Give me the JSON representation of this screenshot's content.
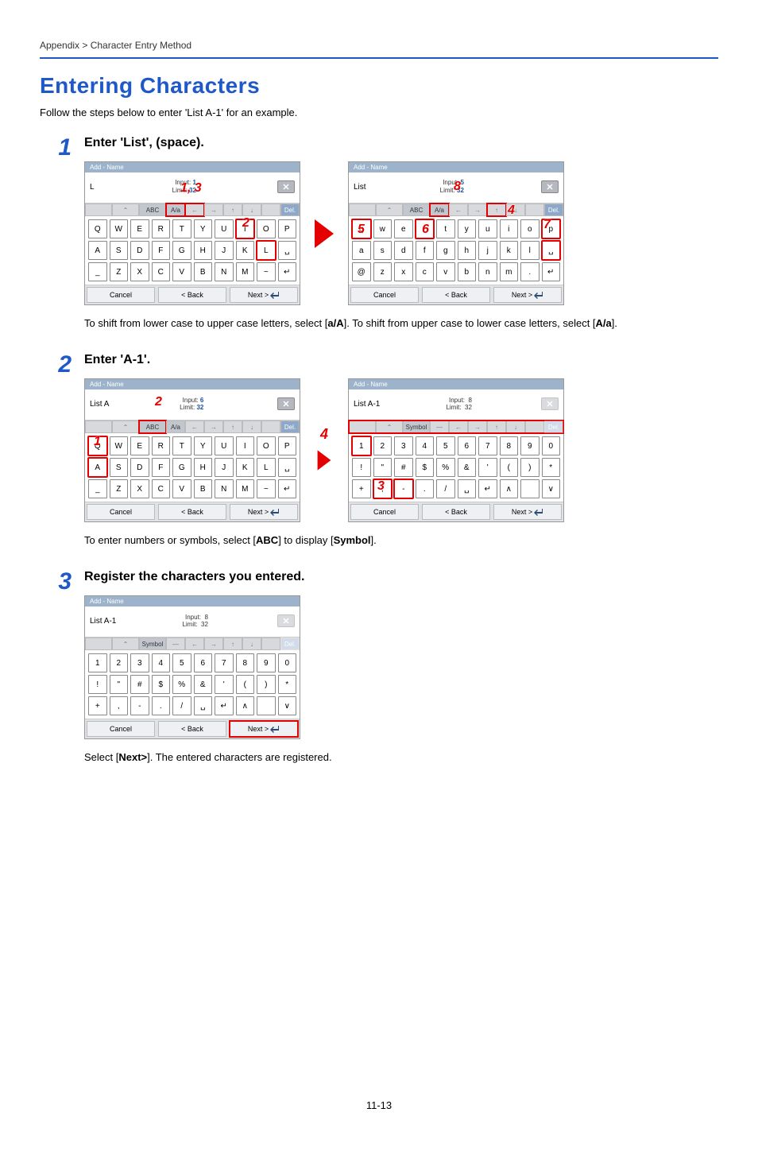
{
  "breadcrumb": "Appendix > Character Entry Method",
  "page_title": "Entering Characters",
  "intro": "Follow the steps below to enter 'List A-1' for an example.",
  "page_number": "11-13",
  "steps": [
    {
      "num": "1",
      "heading": "Enter 'List', (space).",
      "note_pre": "To shift from lower case to upper case letters, select [",
      "note_b1": "a/A",
      "note_mid": "]. To shift from upper case to lower case letters, select [",
      "note_b2": "A/a",
      "note_post": "]."
    },
    {
      "num": "2",
      "heading": "Enter 'A-1'.",
      "note_pre": "To enter numbers or symbols, select [",
      "note_b1": "ABC",
      "note_mid": "] to display [",
      "note_b2": "Symbol",
      "note_post": "]."
    },
    {
      "num": "3",
      "heading": "Register the characters you entered.",
      "note_pre": "Select [",
      "note_b1": "Next>",
      "note_mid": "]. The entered characters are registered.",
      "note_b2": "",
      "note_post": ""
    }
  ],
  "panel_common": {
    "title": "Add - Name",
    "input_label": "Input:",
    "limit_label": "Limit:",
    "limit_val": "32",
    "toolbar": {
      "abc": "ABC",
      "symbol": "Symbol",
      "aa": "A/a",
      "del": "Del."
    },
    "bottom": {
      "cancel": "Cancel",
      "back": "< Back",
      "next": "Next >"
    }
  },
  "panels": {
    "s1a": {
      "val": "L",
      "input_count": "1",
      "case": "upper",
      "callouts": {
        "c13": "1, 3",
        "c2": "2"
      },
      "rows": [
        [
          "Q",
          "W",
          "E",
          "R",
          "T",
          "Y",
          "U",
          "I",
          "O",
          "P"
        ],
        [
          "A",
          "S",
          "D",
          "F",
          "G",
          "H",
          "J",
          "K",
          "L",
          "␣"
        ],
        [
          "_",
          "Z",
          "X",
          "C",
          "V",
          "B",
          "N",
          "M",
          "~",
          "↵"
        ]
      ]
    },
    "s1b": {
      "val": "List",
      "input_count": "5",
      "case": "lower",
      "callouts": {
        "c4": "4",
        "c5": "5",
        "c6": "6",
        "c7": "7",
        "c8": "8"
      },
      "rows": [
        [
          "q",
          "w",
          "e",
          "r",
          "t",
          "y",
          "u",
          "i",
          "o",
          "p"
        ],
        [
          "a",
          "s",
          "d",
          "f",
          "g",
          "h",
          "j",
          "k",
          "l",
          "␣"
        ],
        [
          "@",
          "z",
          "x",
          "c",
          "v",
          "b",
          "n",
          "m",
          ".",
          "↵"
        ]
      ]
    },
    "s2a": {
      "val": "List A",
      "input_count": "6",
      "case": "upper",
      "callouts": {
        "c1": "1",
        "c2": "2"
      },
      "rows": [
        [
          "Q",
          "W",
          "E",
          "R",
          "T",
          "Y",
          "U",
          "I",
          "O",
          "P"
        ],
        [
          "A",
          "S",
          "D",
          "F",
          "G",
          "H",
          "J",
          "K",
          "L",
          "␣"
        ],
        [
          "_",
          "Z",
          "X",
          "C",
          "V",
          "B",
          "N",
          "M",
          "~",
          "↵"
        ]
      ]
    },
    "s2b": {
      "val": "List A-1",
      "input_count": "8",
      "case": "symbol",
      "callouts": {
        "c3": "3"
      },
      "rows": [
        [
          "1",
          "2",
          "3",
          "4",
          "5",
          "6",
          "7",
          "8",
          "9",
          "0"
        ],
        [
          "!",
          "\"",
          "#",
          "$",
          "%",
          "&",
          "'",
          "(",
          ")",
          "*"
        ],
        [
          "+",
          ",",
          "-",
          ".",
          "/",
          "␣",
          "↵",
          "∧",
          "",
          "∨"
        ]
      ]
    },
    "s3": {
      "val": "List A-1",
      "input_count": "8",
      "case": "symbol",
      "rows": [
        [
          "1",
          "2",
          "3",
          "4",
          "5",
          "6",
          "7",
          "8",
          "9",
          "0"
        ],
        [
          "!",
          "\"",
          "#",
          "$",
          "%",
          "&",
          "'",
          "(",
          ")",
          "*"
        ],
        [
          "+",
          ",",
          "-",
          ".",
          "/",
          "␣",
          "↵",
          "∧",
          "",
          "∨"
        ]
      ]
    }
  },
  "step2_between": "4"
}
